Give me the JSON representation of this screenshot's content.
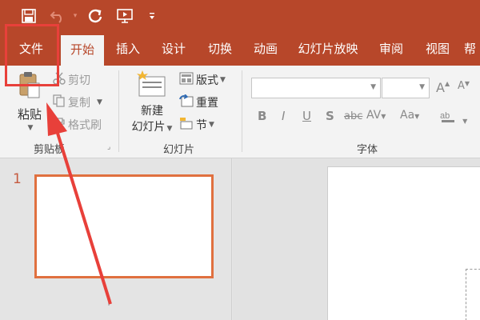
{
  "quick_access": {
    "icons": [
      "save-icon",
      "undo-icon",
      "redo-icon",
      "slideshow-icon",
      "customize-icon"
    ],
    "dropdown_glyph": "▾"
  },
  "tabs": [
    {
      "label": "文件",
      "active": false
    },
    {
      "label": "开始",
      "active": true
    },
    {
      "label": "插入",
      "active": false
    },
    {
      "label": "设计",
      "active": false
    },
    {
      "label": "切换",
      "active": false
    },
    {
      "label": "动画",
      "active": false
    },
    {
      "label": "幻灯片放映",
      "active": false
    },
    {
      "label": "审阅",
      "active": false
    },
    {
      "label": "视图",
      "active": false
    },
    {
      "label": "帮",
      "active": false
    }
  ],
  "clipboard": {
    "paste": "粘贴",
    "cut": "剪切",
    "copy": "复制",
    "format_painter": "格式刷",
    "group_label": "剪贴板"
  },
  "slides_group": {
    "new_slide_line1": "新建",
    "new_slide_line2": "幻灯片",
    "layout": "版式",
    "reset": "重置",
    "section": "节",
    "group_label": "幻灯片"
  },
  "font_group": {
    "font_name_value": "",
    "font_size_value": "",
    "increase": "A",
    "decrease": "A",
    "clear": "A",
    "bold": "B",
    "italic": "I",
    "underline": "U",
    "shadow": "S",
    "strike": "abc",
    "spacing": "AV",
    "case": "Aa",
    "group_label": "字体"
  },
  "thumbnail": {
    "slide_number": "1"
  },
  "colors": {
    "accent": "#b7472a",
    "annotation": "#e8403a"
  }
}
